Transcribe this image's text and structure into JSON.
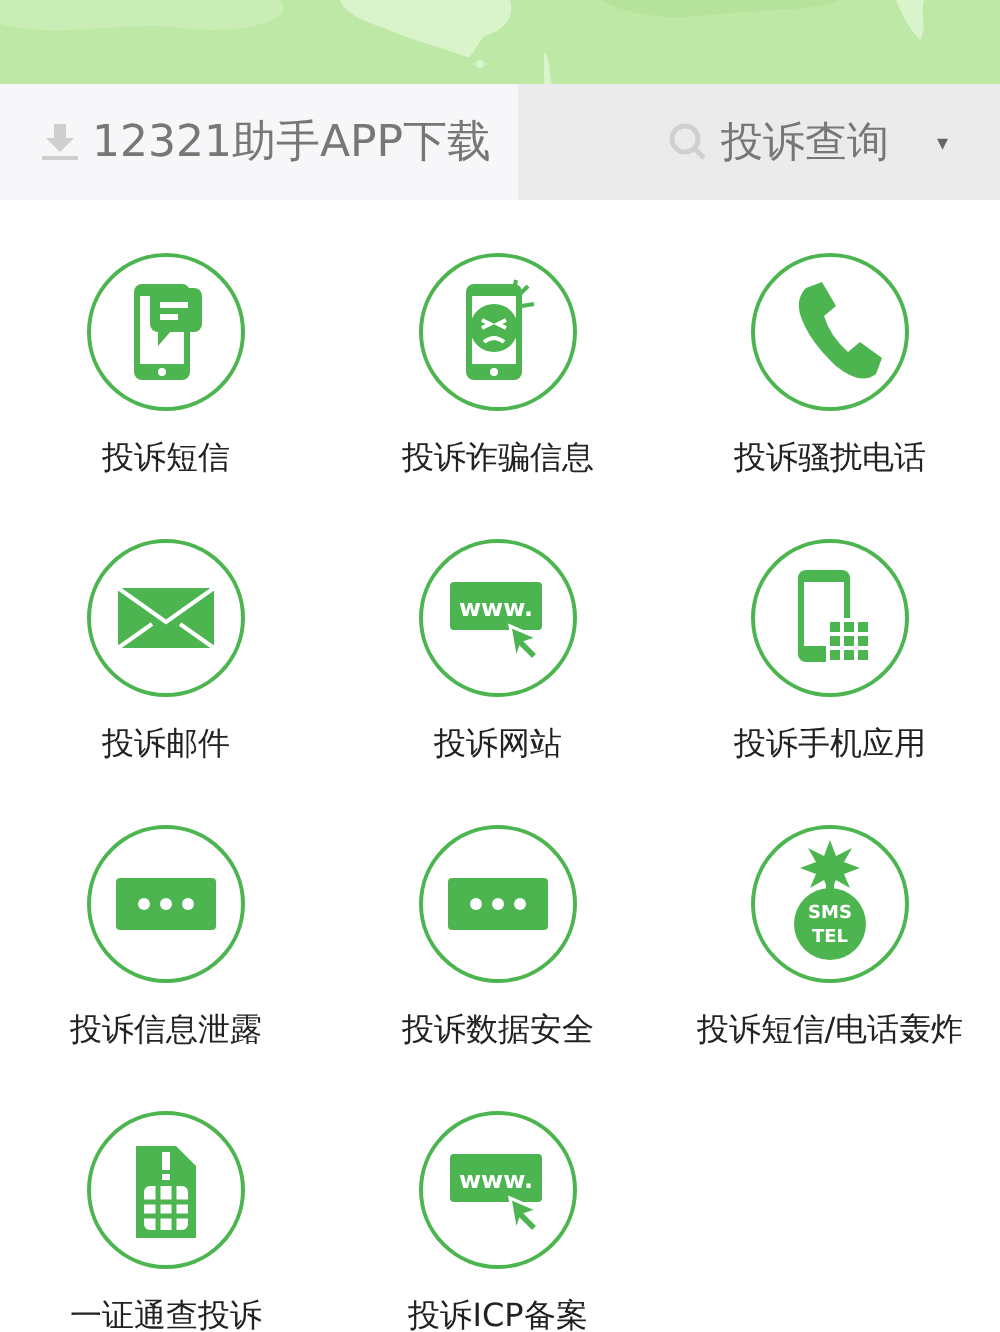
{
  "toolbar": {
    "download": {
      "label": "12321助手APP下载"
    },
    "query": {
      "label": "投诉查询",
      "caret": "▾"
    }
  },
  "items": [
    {
      "label": "投诉短信",
      "kind": "sms"
    },
    {
      "label": "投诉诈骗信息",
      "kind": "fraud"
    },
    {
      "label": "投诉骚扰电话",
      "kind": "phone"
    },
    {
      "label": "投诉邮件",
      "kind": "mail"
    },
    {
      "label": "投诉网站",
      "kind": "web",
      "icon_text": [
        "www."
      ]
    },
    {
      "label": "投诉手机应用",
      "kind": "app"
    },
    {
      "label": "投诉信息泄露",
      "kind": "dots"
    },
    {
      "label": "投诉数据安全",
      "kind": "dots"
    },
    {
      "label": "投诉短信/电话轰炸",
      "kind": "bomb",
      "icon_text": [
        "SMS",
        "TEL"
      ]
    },
    {
      "label": "一证通查投诉",
      "kind": "sim"
    },
    {
      "label": "投诉ICP备案",
      "kind": "web",
      "icon_text": [
        "www."
      ]
    }
  ]
}
